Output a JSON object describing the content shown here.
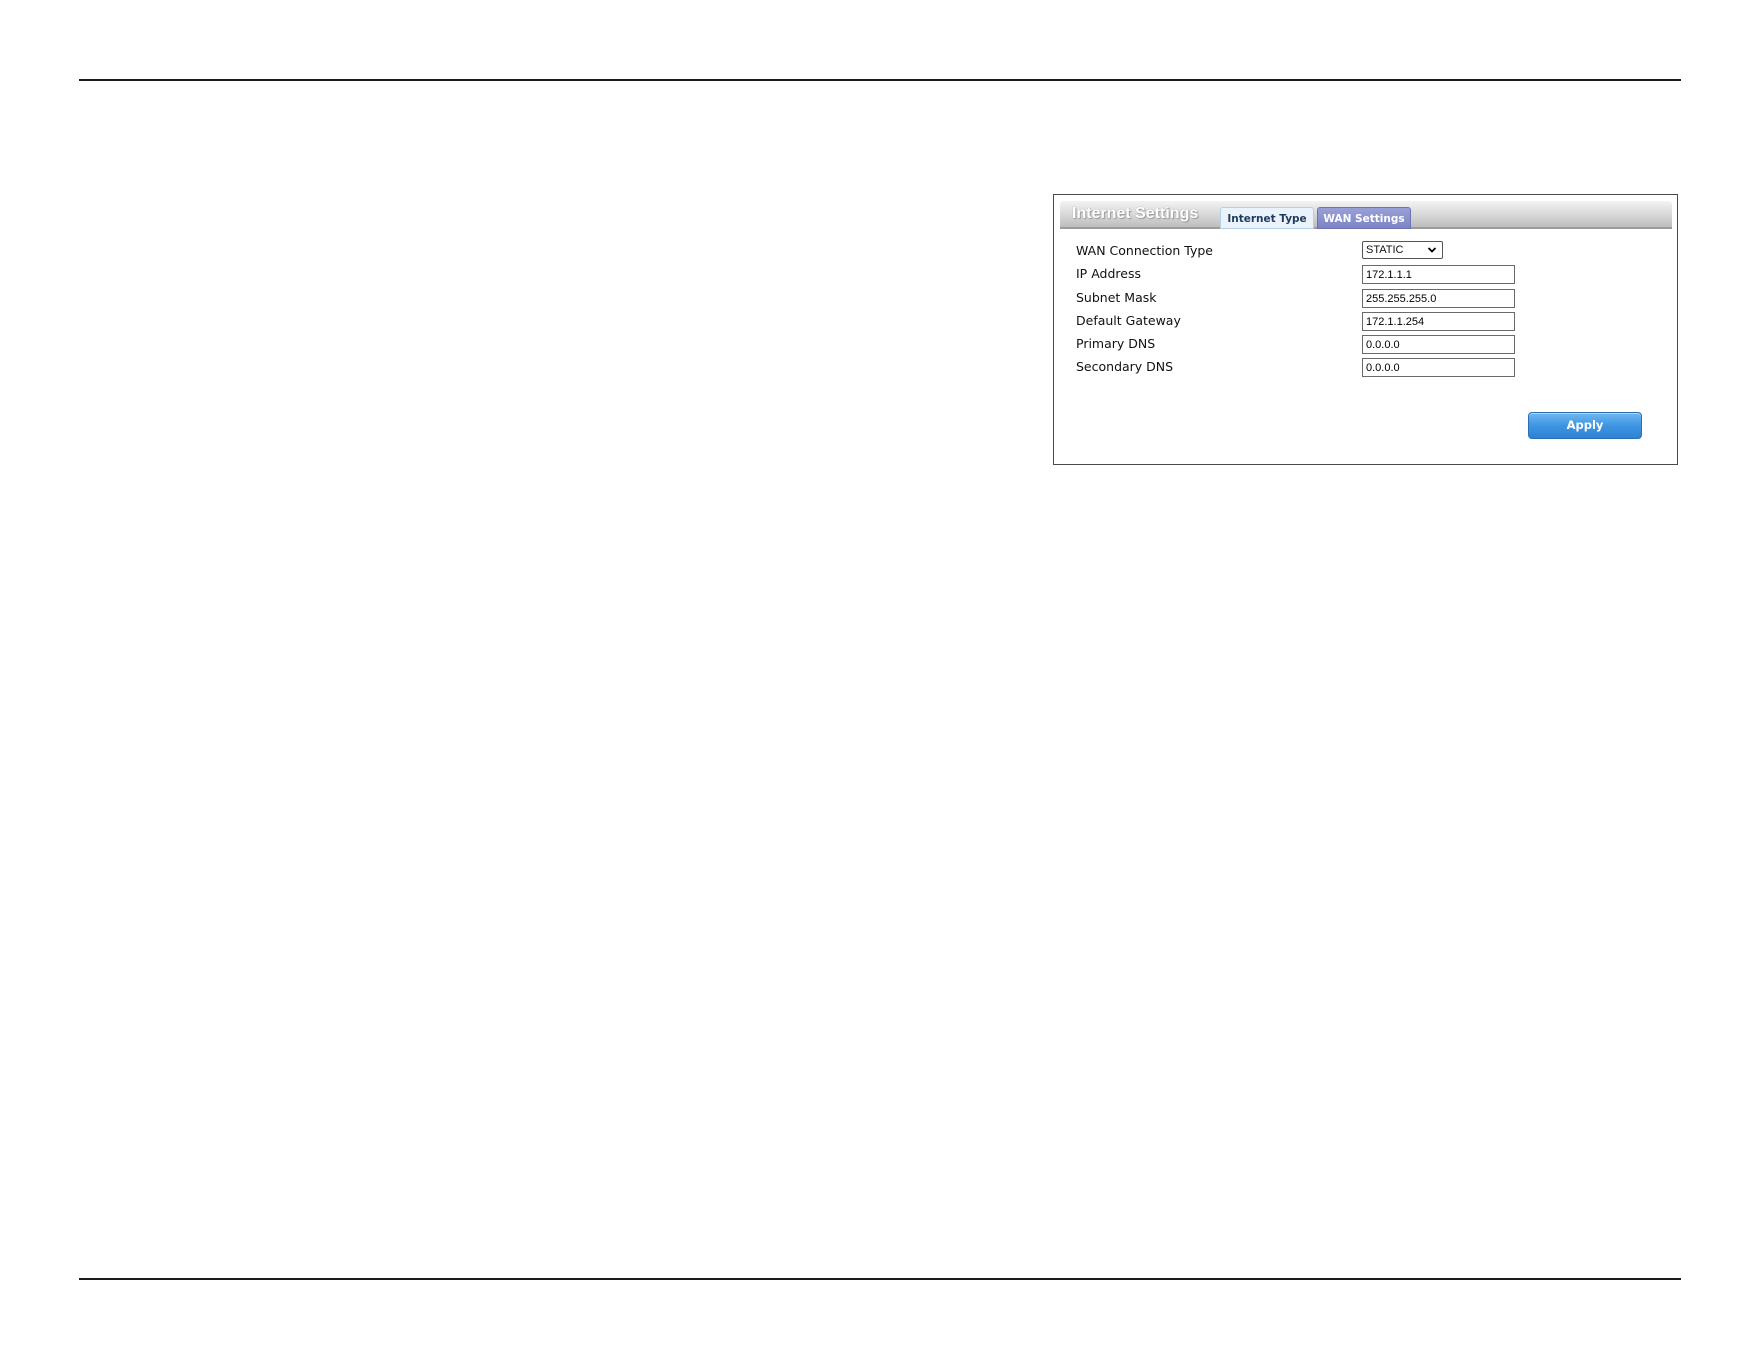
{
  "panel": {
    "title": "Internet Settings",
    "tabs": [
      {
        "label": "Internet Type",
        "active": false
      },
      {
        "label": "WAN Settings",
        "active": true
      }
    ]
  },
  "form": {
    "wan_connection_type": {
      "label": "WAN Connection Type",
      "value": "STATIC"
    },
    "ip_address": {
      "label": "IP Address",
      "value": "172.1.1.1"
    },
    "subnet_mask": {
      "label": "Subnet Mask",
      "value": "255.255.255.0"
    },
    "default_gateway": {
      "label": "Default Gateway",
      "value": "172.1.1.254"
    },
    "primary_dns": {
      "label": "Primary DNS",
      "value": "0.0.0.0"
    },
    "secondary_dns": {
      "label": "Secondary DNS",
      "value": "0.0.0.0"
    }
  },
  "actions": {
    "apply_label": "Apply"
  },
  "icons": {
    "select_arrow": "chevron-down-icon"
  },
  "colors": {
    "active_tab": "#8a90ce",
    "inactive_tab": "#eaf3fb",
    "apply_button": "#3f95e2"
  }
}
